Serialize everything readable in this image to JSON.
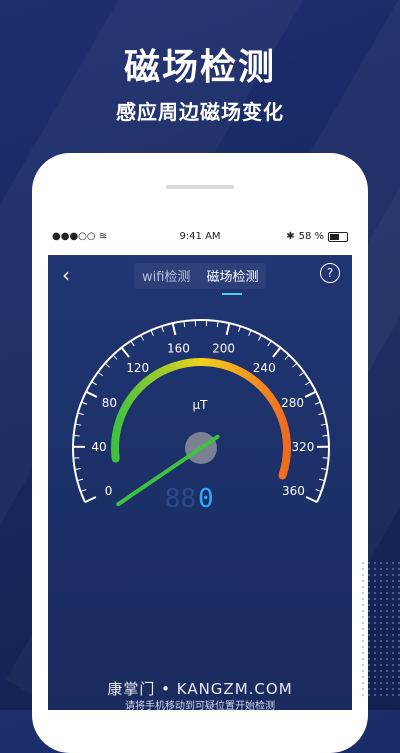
{
  "promo": {
    "title": "磁场检测",
    "subtitle": "感应周边磁场变化"
  },
  "status_bar": {
    "signal": "●●●○○",
    "time": "9:41 AM",
    "battery": "58 %"
  },
  "nav": {
    "back_icon": "chevron-left-icon",
    "tabs": [
      {
        "label": "wifi检测",
        "active": false
      },
      {
        "label": "磁场检测",
        "active": true
      }
    ],
    "help_label": "?"
  },
  "gauge": {
    "unit": "μT",
    "reading": "0",
    "digits_placeholder": "88",
    "min": 0,
    "max": 360,
    "ticks": [
      "0",
      "40",
      "80",
      "120",
      "160",
      "200",
      "240",
      "280",
      "320",
      "360"
    ]
  },
  "hint": "请将手机移动到可疑位置开始检测",
  "watermark": "康掌门 • KANGZM.COM",
  "colors": {
    "background": "#1c2f67",
    "needle": "#3ec23e",
    "arc_start": "#3ec23e",
    "arc_mid": "#f2d21c",
    "arc_end": "#f06a20",
    "readout": "#2fa8ff"
  }
}
